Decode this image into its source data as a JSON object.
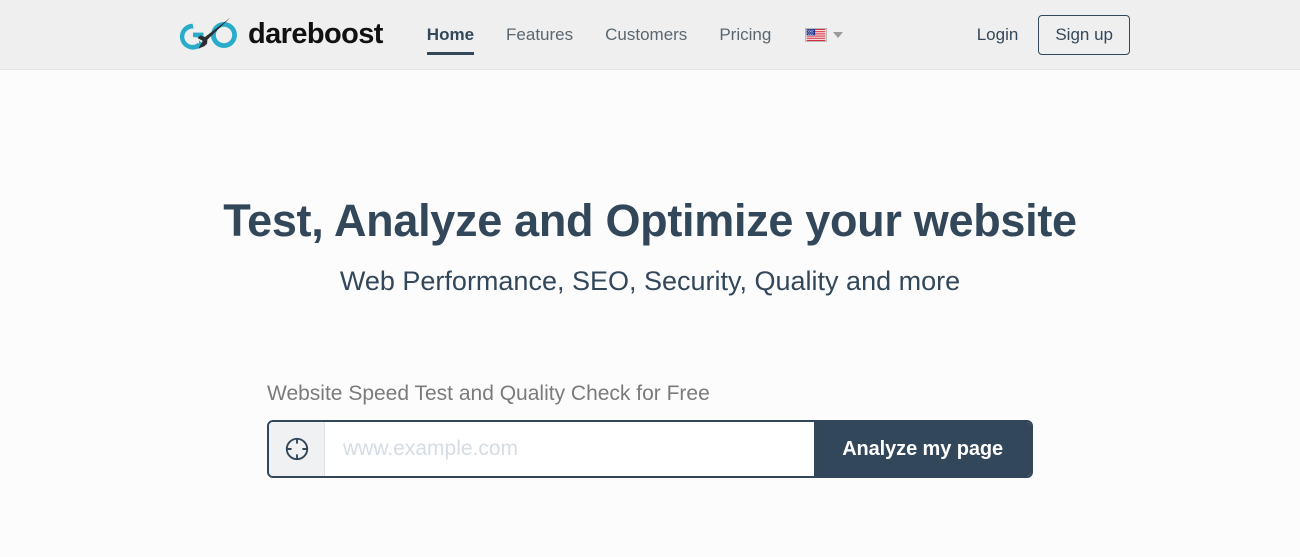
{
  "header": {
    "brand": {
      "wordmark": "dareboost",
      "logo_icon": "dareboost-rocket-logo",
      "logo_color": "#29abca",
      "wordmark_color": "#111111"
    },
    "nav": [
      {
        "label": "Home",
        "active": true
      },
      {
        "label": "Features",
        "active": false
      },
      {
        "label": "Customers",
        "active": false
      },
      {
        "label": "Pricing",
        "active": false
      }
    ],
    "language": {
      "flag_icon": "us-flag-icon",
      "caret_icon": "chevron-down-icon"
    },
    "actions": {
      "login_label": "Login",
      "signup_label": "Sign up"
    },
    "background_color": "#efefef"
  },
  "hero": {
    "title": "Test, Analyze and Optimize your website",
    "subtitle": "Web Performance, SEO, Security, Quality and more",
    "title_color": "#33475b"
  },
  "analyze": {
    "label": "Website Speed Test and Quality Check for Free",
    "url_icon": "crosshair-target-icon",
    "url_value": "",
    "url_placeholder": "www.example.com",
    "submit_label": "Analyze my page",
    "submit_color": "#33475b"
  }
}
